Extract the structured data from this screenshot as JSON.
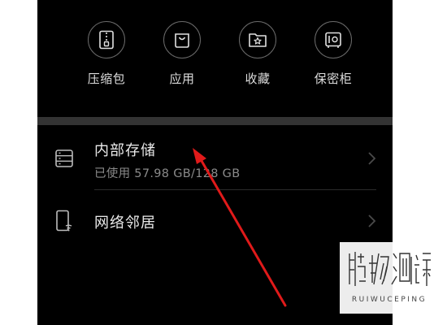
{
  "quick_access": [
    {
      "label": "压缩包",
      "icon": "archive-icon"
    },
    {
      "label": "应用",
      "icon": "shopping-bag-icon"
    },
    {
      "label": "收藏",
      "icon": "star-folder-icon"
    },
    {
      "label": "保密柜",
      "icon": "safe-icon"
    }
  ],
  "storage": {
    "internal": {
      "title": "内部存储",
      "usage": "已使用 57.98 GB/128 GB",
      "icon": "storage-icon"
    },
    "network": {
      "title": "网络邻居",
      "icon": "network-device-icon"
    }
  },
  "watermark": {
    "text": "RUIWUCEPING",
    "logo": "瑞物测评"
  },
  "colors": {
    "background": "#000000",
    "divider": "#333333",
    "primary_text": "#eaeaea",
    "secondary_text": "#8a8a8a",
    "annotation_arrow": "#e01a1a"
  }
}
